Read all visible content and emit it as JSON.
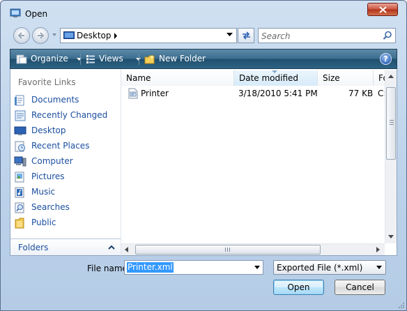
{
  "window": {
    "title": "Open"
  },
  "address": {
    "path": "Desktop"
  },
  "search": {
    "placeholder": "Search"
  },
  "toolbar": {
    "organize": "Organize",
    "views": "Views",
    "new_folder": "New Folder",
    "help": "?"
  },
  "sidebar": {
    "header": "Favorite Links",
    "items": [
      {
        "label": "Documents",
        "icon": "documents-icon"
      },
      {
        "label": "Recently Changed",
        "icon": "recently-changed-icon"
      },
      {
        "label": "Desktop",
        "icon": "desktop-icon"
      },
      {
        "label": "Recent Places",
        "icon": "recent-places-icon"
      },
      {
        "label": "Computer",
        "icon": "computer-icon"
      },
      {
        "label": "Pictures",
        "icon": "pictures-icon"
      },
      {
        "label": "Music",
        "icon": "music-icon"
      },
      {
        "label": "Searches",
        "icon": "searches-icon"
      },
      {
        "label": "Public",
        "icon": "public-folder-icon"
      }
    ],
    "folders_label": "Folders"
  },
  "filelist": {
    "columns": [
      "Name",
      "Date modified",
      "Size",
      "Fo"
    ],
    "sorted_column": "Date modified",
    "rows": [
      {
        "name": "Printer",
        "date": "3/18/2010 5:41 PM",
        "size": "77 KB",
        "folder": "C:"
      }
    ]
  },
  "bottom": {
    "filename_label": "File name:",
    "filename_value": "Printer.xml",
    "filetype_value": "Exported File (*.xml)",
    "open_label": "Open",
    "cancel_label": "Cancel"
  },
  "colors": {
    "accent": "#3399ff",
    "toolbar": "#2d6384",
    "link": "#1c4fa0"
  }
}
